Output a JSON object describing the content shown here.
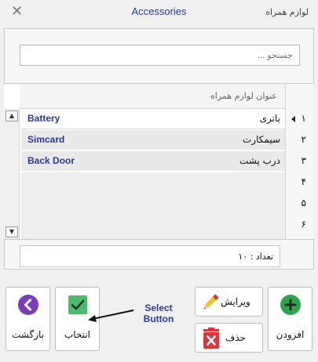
{
  "window": {
    "title": "Accessories",
    "title_fa": "لوازم همراه",
    "close_glyph": "✕"
  },
  "search": {
    "placeholder": "جستجو ..."
  },
  "grid": {
    "column_header": "عنوان لوازم همراه",
    "rows": [
      {
        "num": "۱",
        "name_fa": "باتری",
        "name_en": "Battery"
      },
      {
        "num": "۲",
        "name_fa": "سیمکارت",
        "name_en": "Simcard"
      },
      {
        "num": "۳",
        "name_fa": "درب پشت",
        "name_en": "Back Door"
      },
      {
        "num": "۴",
        "name_fa": "",
        "name_en": ""
      },
      {
        "num": "۵",
        "name_fa": "",
        "name_en": ""
      },
      {
        "num": "۶",
        "name_fa": "",
        "name_en": ""
      }
    ],
    "scroll_up": "▲",
    "scroll_down": "▼"
  },
  "footer": {
    "count_label": "تعداد : ۱۰"
  },
  "buttons": {
    "back": "بازگشت",
    "select": "انتخاب",
    "edit": "ویرایش",
    "delete": "حذف",
    "add": "افزودن"
  },
  "annotation": {
    "line1": "Select",
    "line2": "Button"
  },
  "colors": {
    "title_blue": "#2b3a9b",
    "back_purple": "#7b3fb3",
    "select_green": "#4cbb6c",
    "delete_red": "#d9363e",
    "add_green": "#2ea44f",
    "edit_yellow": "#f2c230"
  }
}
